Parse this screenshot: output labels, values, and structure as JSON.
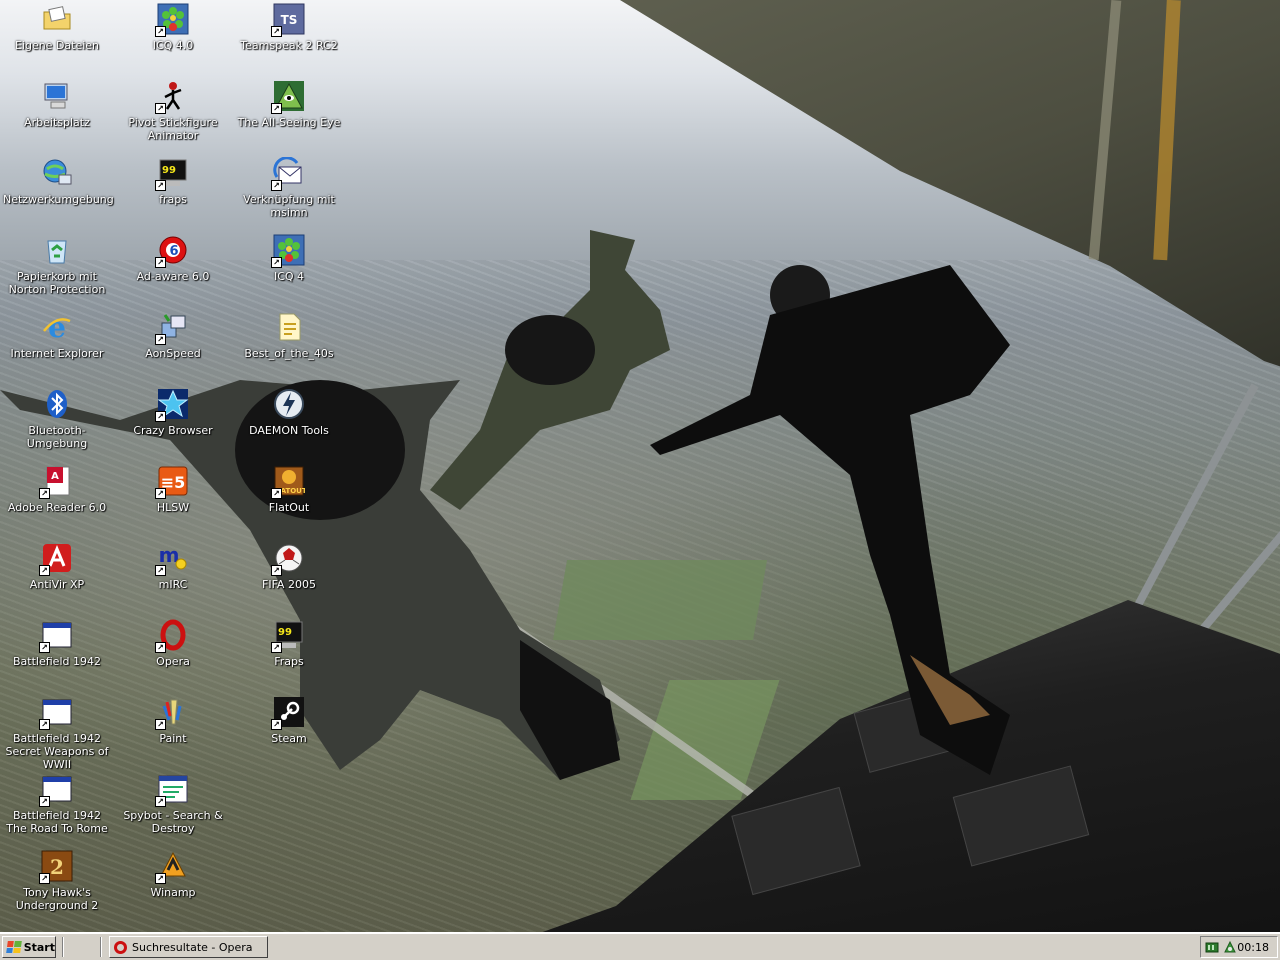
{
  "desktop": {
    "icons": [
      {
        "label": "Eigene Dateien",
        "icon": "folder-documents-icon",
        "shortcut": false
      },
      {
        "label": "ICQ 4.0",
        "icon": "icq-flower-icon",
        "shortcut": true
      },
      {
        "label": "Teamspeak 2 RC2",
        "icon": "teamspeak-icon",
        "shortcut": true
      },
      {
        "label": "Arbeitsplatz",
        "icon": "my-computer-icon",
        "shortcut": false
      },
      {
        "label": "Pivot Stickfigure Animator",
        "icon": "stickfigure-icon",
        "shortcut": true
      },
      {
        "label": "The All-Seeing Eye",
        "icon": "all-seeing-eye-icon",
        "shortcut": true
      },
      {
        "label": "Netzwerkumgebung",
        "icon": "network-places-icon",
        "shortcut": false
      },
      {
        "label": "fraps",
        "icon": "fraps-icon",
        "shortcut": true
      },
      {
        "label": "Verknüpfung mit msimn",
        "icon": "outlook-express-icon",
        "shortcut": true
      },
      {
        "label": "Papierkorb mit Norton Protection",
        "icon": "recycle-bin-icon",
        "shortcut": false
      },
      {
        "label": "Ad-aware 6.0",
        "icon": "adaware-icon",
        "shortcut": true
      },
      {
        "label": "ICQ 4",
        "icon": "icq-flower-icon",
        "shortcut": true
      },
      {
        "label": "Internet Explorer",
        "icon": "internet-explorer-icon",
        "shortcut": false
      },
      {
        "label": "AonSpeed",
        "icon": "aonspeed-icon",
        "shortcut": true
      },
      {
        "label": "Best_of_the_40s",
        "icon": "document-icon",
        "shortcut": false
      },
      {
        "label": "Bluetooth-Umgebung",
        "icon": "bluetooth-icon",
        "shortcut": false
      },
      {
        "label": "Crazy Browser",
        "icon": "crazy-browser-icon",
        "shortcut": true
      },
      {
        "label": "DAEMON Tools",
        "icon": "daemon-tools-icon",
        "shortcut": false
      },
      {
        "label": "Adobe Reader 6.0",
        "icon": "adobe-reader-icon",
        "shortcut": true
      },
      {
        "label": "HLSW",
        "icon": "hlsw-icon",
        "shortcut": true
      },
      {
        "label": "FlatOut",
        "icon": "flatout-icon",
        "shortcut": true
      },
      {
        "label": "AntiVir XP",
        "icon": "antivir-icon",
        "shortcut": true
      },
      {
        "label": "mIRC",
        "icon": "mirc-icon",
        "shortcut": true
      },
      {
        "label": "FIFA 2005",
        "icon": "fifa-ball-icon",
        "shortcut": true
      },
      {
        "label": "Battlefield 1942",
        "icon": "application-window-icon",
        "shortcut": true
      },
      {
        "label": "Opera",
        "icon": "opera-icon",
        "shortcut": true
      },
      {
        "label": "Fraps",
        "icon": "fraps-icon",
        "shortcut": true
      },
      {
        "label": "Battlefield 1942 Secret Weapons of WWII",
        "icon": "application-window-icon",
        "shortcut": true
      },
      {
        "label": "Paint",
        "icon": "paint-icon",
        "shortcut": true
      },
      {
        "label": "Steam",
        "icon": "steam-icon",
        "shortcut": true
      },
      {
        "label": "Battlefield 1942 The Road To Rome",
        "icon": "application-window-icon",
        "shortcut": true
      },
      {
        "label": "Spybot - Search & Destroy",
        "icon": "spybot-icon",
        "shortcut": true
      },
      {
        "label": "Tony Hawk's Underground 2",
        "icon": "tony-hawk-icon",
        "shortcut": true
      },
      {
        "label": "Winamp",
        "icon": "winamp-icon",
        "shortcut": true
      }
    ]
  },
  "taskbar": {
    "start_label": "Start",
    "tasks": [
      {
        "label": "Suchresultate - Opera",
        "icon": "opera-icon"
      }
    ],
    "tray": {
      "icons": [
        "network-tray-icon",
        "security-tray-icon"
      ],
      "clock": "00:18"
    }
  },
  "colors": {
    "taskbar": "#d4d0c8",
    "label_text": "#ffffff",
    "opera_red": "#cc1010"
  }
}
